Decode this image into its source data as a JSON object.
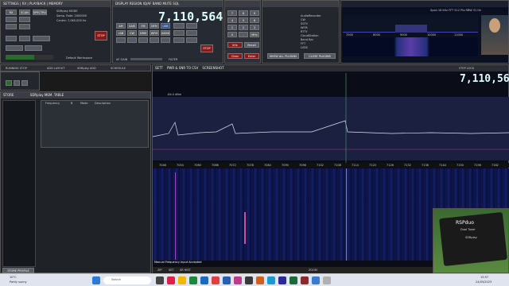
{
  "main_freq": "7,110,564",
  "sub_freq": "7,110,564",
  "panel_a": {
    "tabs": [
      "SETTINGS",
      "RX",
      "PLAYBACK",
      "MEMORY"
    ],
    "row1": [
      "RX",
      "SCAN",
      "SPECTRUM"
    ],
    "mode": "SDRplay MODE",
    "sample_rate": "Samp. Rate: 2000000",
    "center": "Centre: 7,060,000 Hz",
    "preset": "Default Workspace",
    "stop": "STOP"
  },
  "panel_b": {
    "tabs": [
      "DISPLAY",
      "REGION",
      "IQ/AF",
      "BAND",
      "MUTE",
      "SQL"
    ],
    "modes": [
      "AM",
      "SAM",
      "FM",
      "NFM",
      "USB",
      "LSB",
      "CW",
      "DRM",
      "WFM",
      "ADSB"
    ],
    "af_gain": "AF GAIN",
    "filter": "FILTER",
    "stop": "STOP"
  },
  "keypad": {
    "keys": [
      "7",
      "8",
      "9",
      "4",
      "5",
      "6",
      "1",
      "2",
      "3",
      "0",
      ".",
      "MHz",
      "kHz",
      "Clear",
      "Enter",
      "Recall"
    ]
  },
  "decoder_list": {
    "items": [
      "AudioRecorder",
      "CW",
      "SSTV",
      "WFM",
      "RTTY",
      "CloudStation",
      "Band Bar",
      "FFT",
      "LVDS"
    ],
    "btn_left": "SHOW ALL PLUGINS",
    "btn_right": "CLOSE PLUGINS"
  },
  "mini_spectrum": {
    "title": "Span 16 kHz  FFT 512 Pts  RBW 31 Hz",
    "ticks": [
      "7000",
      "8000",
      "9000",
      "10000",
      "11000"
    ]
  },
  "toolbar2": {
    "items": [
      "RUNNING STOP",
      "ADD LAYOUT",
      "SDRplay ADD",
      "SCHEDULE"
    ]
  },
  "memory_panel": {
    "title": "SDRplay MEM. TABLE",
    "store": "STORE",
    "store_profile": "STORE PROFILE",
    "columns": [
      "Frequency",
      "B",
      "Mode",
      "Description"
    ]
  },
  "main_spectrum": {
    "topbar": [
      "SETT",
      "PWR & SNR TO CSV",
      "SCREENSHOT"
    ],
    "step": "STEP LOCK",
    "info": "Span 125 kHz  FFT 32768 Pts  RBW 61.04 Hz  Median 6.5 Hz",
    "db_top": "-84.0 dBm",
    "freq_ticks": [
      "7046",
      "7054",
      "7060",
      "7066",
      "7072",
      "7078",
      "7084",
      "7090",
      "7096",
      "7102",
      "7108",
      "7114",
      "7120",
      "7126",
      "7132",
      "7138",
      "7144",
      "7150",
      "7156",
      "7162"
    ],
    "status": "Manual Frequency Input Accepted",
    "bottom_tabs": [
      "ZIP",
      "SET",
      "SR HIST",
      "ZOOM"
    ]
  },
  "taskbar": {
    "weather_temp": "10°C",
    "weather_text": "Partly sunny",
    "search": "Search",
    "time": "15:57",
    "date": "24/05/2023"
  },
  "device": {
    "brand": "RSPduo",
    "line2": "Dual Tuner",
    "line3": "SDRplay"
  }
}
